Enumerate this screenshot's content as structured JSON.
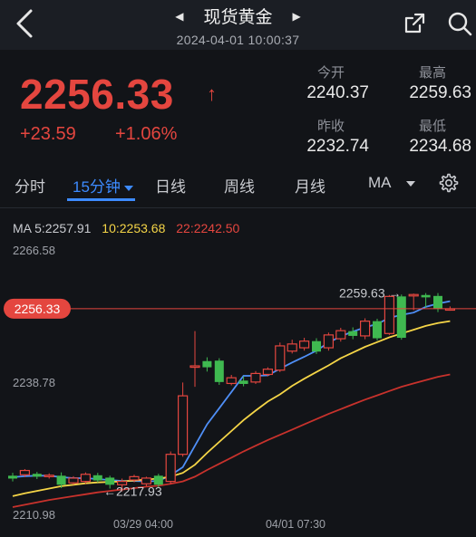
{
  "header": {
    "title": "现货黄金",
    "datetime": "2024-04-01 10:00:37",
    "back_icon": "chevron-left-icon",
    "prev_icon": "triangle-left-icon",
    "next_icon": "triangle-right-icon",
    "share_icon": "share-icon",
    "search_icon": "search-icon"
  },
  "quote": {
    "price": "2256.33",
    "arrow": "↑",
    "change": "+23.59",
    "change_pct": "+1.06%",
    "open_label": "今开",
    "open": "2240.37",
    "high_label": "最高",
    "high": "2259.63",
    "prev_close_label": "昨收",
    "prev_close": "2232.74",
    "low_label": "最低",
    "low": "2234.68",
    "color_up": "#e4463f"
  },
  "tabs": [
    {
      "label": "分时"
    },
    {
      "label": "15分钟",
      "active": true
    },
    {
      "label": "日线"
    },
    {
      "label": "周线"
    },
    {
      "label": "月线"
    },
    {
      "label": "MA"
    }
  ],
  "settings_icon": "gear-icon",
  "ma_legend": {
    "ma5": "MA 5:2257.91",
    "ma10": "10:2253.68",
    "ma22": "22:2242.50",
    "ma5_color": "#4f8ff7",
    "ma10_color": "#f5d547",
    "ma22_color": "#c8322c"
  },
  "chart_data": {
    "type": "candlestick",
    "y_axis_labels": [
      "2266.58",
      "2238.78",
      "2210.98"
    ],
    "ylim": [
      2210.98,
      2266.58
    ],
    "current_price_label": "2256.33",
    "current_price": 2256.33,
    "high_annotation": "2259.63",
    "low_annotation": "2217.93",
    "x_labels": [
      "03/29 04:00",
      "04/01 07:30"
    ],
    "candles": [
      {
        "o": 2221.2,
        "c": 2220.6,
        "h": 2221.8,
        "l": 2220.0
      },
      {
        "o": 2221.4,
        "c": 2222.3,
        "h": 2222.6,
        "l": 2220.9
      },
      {
        "o": 2221.6,
        "c": 2221.0,
        "h": 2222.0,
        "l": 2220.5
      },
      {
        "o": 2221.0,
        "c": 2221.3,
        "h": 2221.7,
        "l": 2220.6
      },
      {
        "o": 2221.2,
        "c": 2219.3,
        "h": 2221.9,
        "l": 2218.6
      },
      {
        "o": 2219.7,
        "c": 2220.7,
        "h": 2221.1,
        "l": 2219.3
      },
      {
        "o": 2220.0,
        "c": 2221.5,
        "h": 2221.9,
        "l": 2219.5
      },
      {
        "o": 2221.3,
        "c": 2220.2,
        "h": 2221.8,
        "l": 2219.8
      },
      {
        "o": 2220.8,
        "c": 2219.3,
        "h": 2221.2,
        "l": 2218.5
      },
      {
        "o": 2219.3,
        "c": 2220.0,
        "h": 2220.6,
        "l": 2217.9
      },
      {
        "o": 2220.3,
        "c": 2221.0,
        "h": 2221.4,
        "l": 2219.8
      },
      {
        "o": 2219.5,
        "c": 2220.7,
        "h": 2221.0,
        "l": 2219.0
      },
      {
        "o": 2221.2,
        "c": 2219.3,
        "h": 2221.6,
        "l": 2218.8
      },
      {
        "o": 2220.0,
        "c": 2225.7,
        "h": 2226.3,
        "l": 2219.4
      },
      {
        "o": 2225.7,
        "c": 2238.0,
        "h": 2240.8,
        "l": 2225.2
      },
      {
        "o": 2244.0,
        "c": 2244.3,
        "h": 2251.6,
        "l": 2239.9
      },
      {
        "o": 2245.3,
        "c": 2244.0,
        "h": 2246.1,
        "l": 2243.1
      },
      {
        "o": 2245.4,
        "c": 2240.9,
        "h": 2245.9,
        "l": 2240.3
      },
      {
        "o": 2240.6,
        "c": 2241.8,
        "h": 2242.4,
        "l": 2240.2
      },
      {
        "o": 2241.2,
        "c": 2240.5,
        "h": 2242.1,
        "l": 2240.0
      },
      {
        "o": 2240.9,
        "c": 2242.7,
        "h": 2243.2,
        "l": 2240.5
      },
      {
        "o": 2242.5,
        "c": 2243.6,
        "h": 2244.0,
        "l": 2242.1
      },
      {
        "o": 2243.4,
        "c": 2248.5,
        "h": 2249.2,
        "l": 2243.0
      },
      {
        "o": 2247.4,
        "c": 2248.9,
        "h": 2249.8,
        "l": 2246.9
      },
      {
        "o": 2248.1,
        "c": 2249.5,
        "h": 2250.2,
        "l": 2247.5
      },
      {
        "o": 2249.5,
        "c": 2247.3,
        "h": 2250.1,
        "l": 2246.8
      },
      {
        "o": 2248.1,
        "c": 2250.8,
        "h": 2251.3,
        "l": 2247.5
      },
      {
        "o": 2250.0,
        "c": 2251.7,
        "h": 2252.3,
        "l": 2249.4
      },
      {
        "o": 2251.6,
        "c": 2250.6,
        "h": 2252.4,
        "l": 2249.9
      },
      {
        "o": 2250.6,
        "c": 2253.7,
        "h": 2254.3,
        "l": 2249.9
      },
      {
        "o": 2253.7,
        "c": 2250.1,
        "h": 2254.2,
        "l": 2249.6
      },
      {
        "o": 2251.1,
        "c": 2258.9,
        "h": 2259.2,
        "l": 2250.8
      },
      {
        "o": 2258.9,
        "c": 2250.2,
        "h": 2259.3,
        "l": 2249.8
      },
      {
        "o": 2259.0,
        "c": 2259.3,
        "h": 2259.5,
        "l": 2256.0
      },
      {
        "o": 2259.2,
        "c": 2258.7,
        "h": 2259.6,
        "l": 2256.5
      },
      {
        "o": 2259.0,
        "c": 2256.3,
        "h": 2259.6,
        "l": 2255.6
      },
      {
        "o": 2256.3,
        "c": 2256.3,
        "h": 2256.8,
        "l": 2255.9
      }
    ],
    "series": [
      {
        "name": "MA5",
        "color": "#4f8ff7",
        "values": [
          2220.9,
          2221.1,
          2221.2,
          2221.2,
          2220.9,
          2220.7,
          2220.7,
          2220.5,
          2220.3,
          2220.1,
          2220.1,
          2220.0,
          2220.1,
          2221.3,
          2223.0,
          2227.5,
          2232.0,
          2235.4,
          2238.8,
          2242.2,
          2242.2,
          2242.3,
          2243.7,
          2245.0,
          2246.2,
          2247.5,
          2249.2,
          2250.5,
          2251.5,
          2252.4,
          2253.1,
          2254.4,
          2255.0,
          2255.5,
          2256.7,
          2257.4,
          2257.9
        ]
      },
      {
        "name": "MA10",
        "color": "#f5d547",
        "values": [
          2216.9,
          2217.5,
          2218.0,
          2218.5,
          2219.0,
          2219.3,
          2219.6,
          2219.8,
          2219.9,
          2220.0,
          2220.2,
          2220.4,
          2220.6,
          2221.0,
          2221.8,
          2223.5,
          2226.0,
          2228.3,
          2230.6,
          2232.9,
          2234.9,
          2236.8,
          2238.3,
          2240.1,
          2241.6,
          2243.0,
          2244.4,
          2245.9,
          2247.1,
          2248.3,
          2249.3,
          2250.3,
          2251.1,
          2251.9,
          2252.7,
          2253.3,
          2253.7
        ]
      },
      {
        "name": "MA22",
        "color": "#c8322c",
        "values": [
          2214.6,
          2215.1,
          2215.6,
          2216.1,
          2216.5,
          2216.9,
          2217.3,
          2217.7,
          2218.0,
          2218.3,
          2218.6,
          2218.9,
          2219.1,
          2219.5,
          2220.0,
          2221.0,
          2222.4,
          2223.7,
          2225.0,
          2226.3,
          2227.5,
          2228.7,
          2229.8,
          2230.9,
          2232.0,
          2233.1,
          2234.2,
          2235.2,
          2236.2,
          2237.2,
          2238.1,
          2239.0,
          2239.9,
          2240.6,
          2241.3,
          2242.0,
          2242.5
        ]
      }
    ],
    "grid": false
  }
}
